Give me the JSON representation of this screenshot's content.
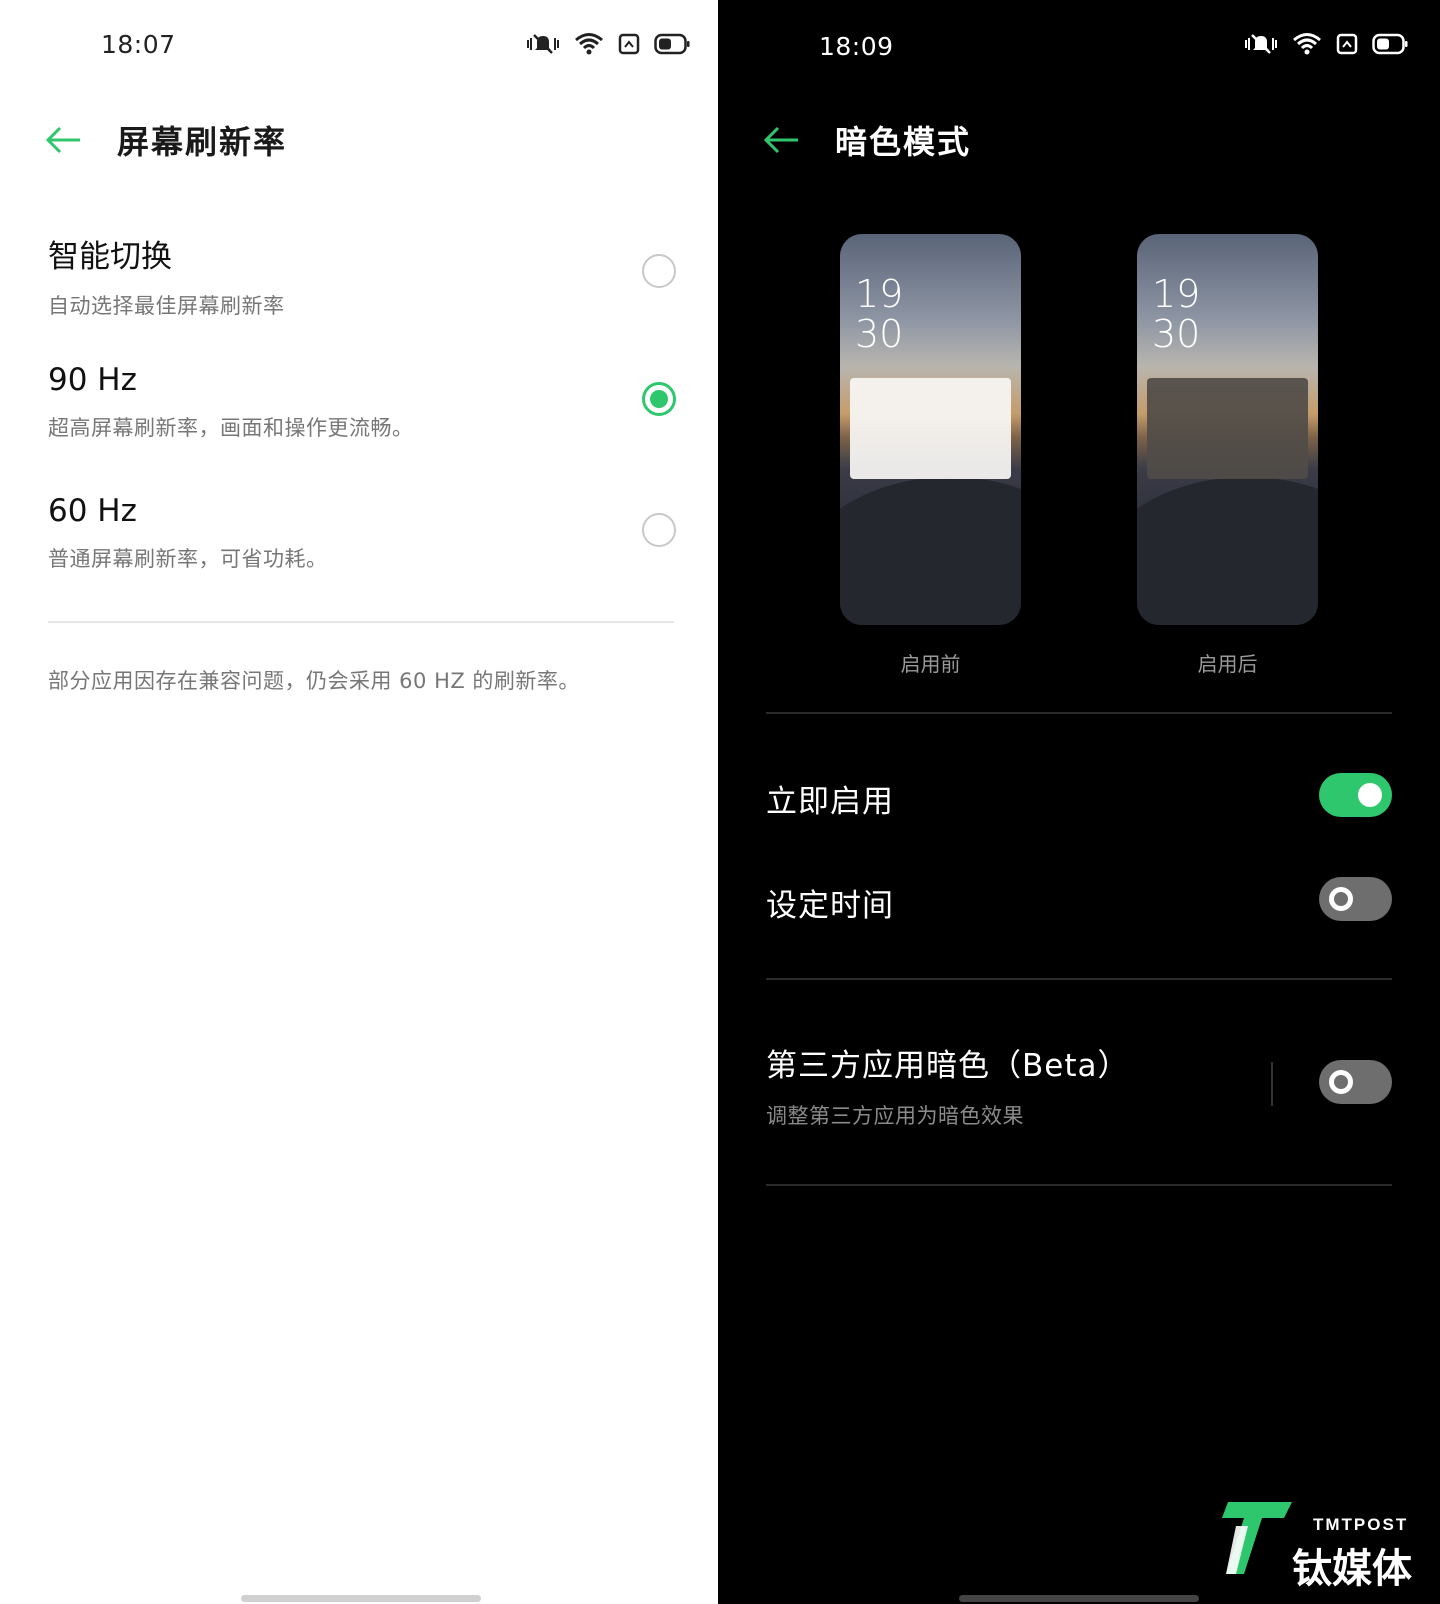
{
  "left": {
    "status_time": "18:07",
    "title": "屏幕刷新率",
    "options": [
      {
        "title": "智能切换",
        "subtitle": "自动选择最佳屏幕刷新率",
        "selected": false
      },
      {
        "title": "90 Hz",
        "subtitle": "超高屏幕刷新率，画面和操作更流畅。",
        "selected": true
      },
      {
        "title": "60 Hz",
        "subtitle": "普通屏幕刷新率，可省功耗。",
        "selected": false
      }
    ],
    "note": "部分应用因存在兼容问题，仍会采用 60 HZ 的刷新率。"
  },
  "right": {
    "status_time": "18:09",
    "title": "暗色模式",
    "previews": [
      {
        "clock_hour": "19",
        "clock_min": "30",
        "label": "启用前"
      },
      {
        "clock_hour": "19",
        "clock_min": "30",
        "label": "启用后"
      }
    ],
    "settings": [
      {
        "title": "立即启用",
        "on": true
      },
      {
        "title": "设定时间",
        "on": false
      },
      {
        "title": "第三方应用暗色（Beta）",
        "subtitle": "调整第三方应用为暗色效果",
        "on": false
      }
    ]
  },
  "status_icons": [
    "mute-vibrate-icon",
    "wifi-icon",
    "nfc-icon",
    "battery-icon"
  ],
  "watermark": {
    "en": "TMTPOST",
    "cn": "钛媒体"
  },
  "colors": {
    "accent": "#2fc76d",
    "dark_bg": "#000000",
    "light_bg": "#ffffff"
  }
}
